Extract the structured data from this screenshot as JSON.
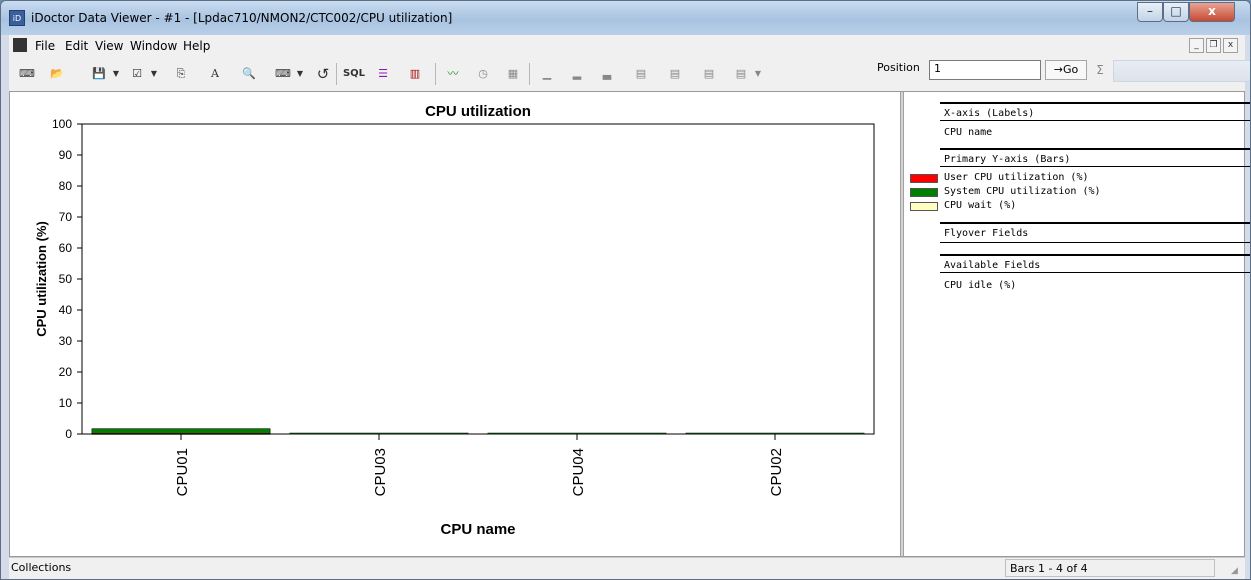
{
  "window": {
    "title": "iDoctor Data Viewer - #1 - [Lpdac710/NMON2/CTC002/CPU utilization]",
    "app_icon_text": "iD",
    "minimize_glyph": "–",
    "maximize_glyph": "□",
    "close_glyph": "x"
  },
  "menu": {
    "items": [
      "File",
      "Edit",
      "View",
      "Window",
      "Help"
    ],
    "mdi_minimize": "_",
    "mdi_restore": "❐",
    "mdi_close": "x"
  },
  "toolbar": {
    "buttons": [
      {
        "icon": "query-icon",
        "glyph": "⌨"
      },
      {
        "icon": "open-folder-icon",
        "glyph": "📂"
      },
      {
        "icon": "save-icon",
        "glyph": "💾"
      },
      {
        "icon": "properties-icon",
        "glyph": "☑"
      },
      {
        "icon": "copy-icon",
        "glyph": "⎘"
      },
      {
        "icon": "font-icon",
        "glyph": "A"
      },
      {
        "icon": "find-icon",
        "glyph": "🔍"
      },
      {
        "icon": "query-definition-icon",
        "glyph": "⌨"
      },
      {
        "icon": "refresh-icon",
        "glyph": "↺"
      },
      {
        "icon": "sql-icon",
        "glyph": "SQL"
      },
      {
        "icon": "legend-icon",
        "glyph": "☰"
      },
      {
        "icon": "bar-graph-icon",
        "glyph": "▥"
      },
      {
        "icon": "line-graph-icon",
        "glyph": "〰"
      },
      {
        "icon": "time-interval-icon",
        "glyph": "◷"
      },
      {
        "icon": "table-icon",
        "glyph": "▦"
      },
      {
        "icon": "bar-width-narrow-icon",
        "glyph": "▁"
      },
      {
        "icon": "bar-width-medium-icon",
        "glyph": "▂"
      },
      {
        "icon": "bar-width-wide-icon",
        "glyph": "▃"
      },
      {
        "icon": "bar-style-1-icon",
        "glyph": "▤"
      },
      {
        "icon": "bar-style-2-icon",
        "glyph": "▤"
      },
      {
        "icon": "bar-style-3-icon",
        "glyph": "▤"
      },
      {
        "icon": "bar-style-4-icon",
        "glyph": "▤"
      }
    ],
    "position_label": "Position",
    "position_value": "1",
    "go_label": "→Go",
    "sigma_glyph": "Σ"
  },
  "legend": {
    "x_axis_header": "X-axis (Labels)",
    "x_axis_field": "CPU name",
    "primary_y_header": "Primary Y-axis (Bars)",
    "series": [
      {
        "label": "User CPU utilization (%)",
        "color": "#ff0000"
      },
      {
        "label": "System CPU utilization (%)",
        "color": "#008000"
      },
      {
        "label": "CPU wait (%)",
        "color": "#ffffc0"
      }
    ],
    "flyover_header": "Flyover Fields",
    "available_header": "Available Fields",
    "available_fields": [
      "CPU idle (%)"
    ]
  },
  "status": {
    "left": "Collections",
    "right": "Bars 1 - 4 of 4"
  },
  "chart_data": {
    "type": "bar",
    "title": "CPU utilization",
    "xlabel": "CPU name",
    "ylabel": "CPU utilization (%)",
    "ylim": [
      0,
      100
    ],
    "yticks": [
      0,
      10,
      20,
      30,
      40,
      50,
      60,
      70,
      80,
      90,
      100
    ],
    "categories": [
      "CPU01",
      "CPU03",
      "CPU04",
      "CPU02"
    ],
    "stacked": true,
    "series": [
      {
        "name": "User CPU utilization (%)",
        "color": "#ff0000",
        "values": [
          0.2,
          0,
          0,
          0
        ]
      },
      {
        "name": "System CPU utilization (%)",
        "color": "#008000",
        "values": [
          1.5,
          0.3,
          0.3,
          0.3
        ]
      },
      {
        "name": "CPU wait (%)",
        "color": "#ffffc0",
        "values": [
          0,
          0,
          0,
          0
        ]
      }
    ],
    "grid": false,
    "legend": "right panel"
  }
}
